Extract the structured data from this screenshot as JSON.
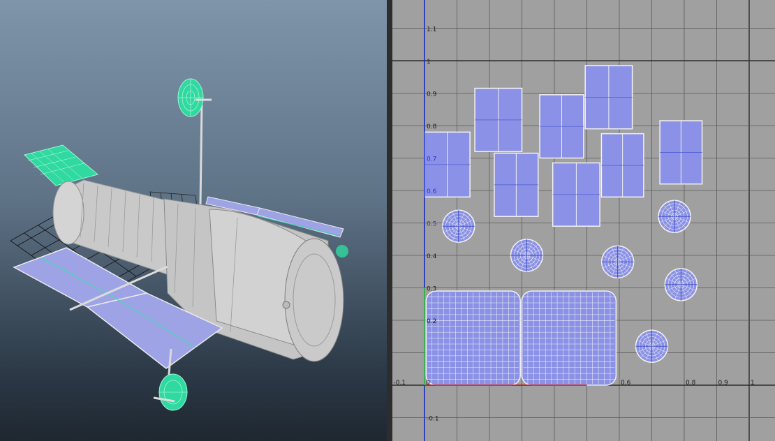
{
  "viewport": {
    "model": "satellite-telescope",
    "colors": {
      "hull": "#c7c7c7",
      "panel": "#9ea3e6",
      "selected_wire": "#33e6a8"
    }
  },
  "uv_editor": {
    "colors": {
      "background": "#a0a0a0",
      "shell_fill": "#8a91e6",
      "grid_line": "#5a5a5a",
      "major_line": "#2e2e2e",
      "u_axis": "#d11a1a",
      "v_axis": "#1a2fd1",
      "wire": "#f2f2f2"
    },
    "u_labels": [
      "-0.1",
      "0",
      "0.6",
      "0.8",
      "0.9",
      "1"
    ],
    "v_labels": [
      "1.1",
      "1",
      "0.9",
      "0.8",
      "0.7",
      "0.6",
      "0.5",
      "0.4",
      "0.3",
      "0.2",
      "-0.1"
    ],
    "shells": {
      "rects": [
        {
          "u": 0.0,
          "v": 0.58,
          "w": 0.14,
          "h": 0.2
        },
        {
          "u": 0.155,
          "v": 0.72,
          "w": 0.145,
          "h": 0.195
        },
        {
          "u": 0.215,
          "v": 0.52,
          "w": 0.135,
          "h": 0.195
        },
        {
          "u": 0.355,
          "v": 0.7,
          "w": 0.135,
          "h": 0.195
        },
        {
          "u": 0.395,
          "v": 0.49,
          "w": 0.145,
          "h": 0.195
        },
        {
          "u": 0.495,
          "v": 0.79,
          "w": 0.145,
          "h": 0.195
        },
        {
          "u": 0.545,
          "v": 0.58,
          "w": 0.13,
          "h": 0.195
        },
        {
          "u": 0.725,
          "v": 0.62,
          "w": 0.13,
          "h": 0.195
        }
      ],
      "discs": [
        {
          "u": 0.105,
          "v": 0.49,
          "r": 0.105
        },
        {
          "u": 0.315,
          "v": 0.4,
          "r": 0.105
        },
        {
          "u": 0.595,
          "v": 0.38,
          "r": 0.105
        },
        {
          "u": 0.77,
          "v": 0.52,
          "r": 0.105
        },
        {
          "u": 0.79,
          "v": 0.31,
          "r": 0.105
        },
        {
          "u": 0.7,
          "v": 0.12,
          "r": 0.105
        }
      ],
      "grids": [
        {
          "u": 0.005,
          "v": 0.0,
          "w": 0.29,
          "h": 0.29
        },
        {
          "u": 0.3,
          "v": 0.0,
          "w": 0.29,
          "h": 0.29
        }
      ]
    }
  }
}
